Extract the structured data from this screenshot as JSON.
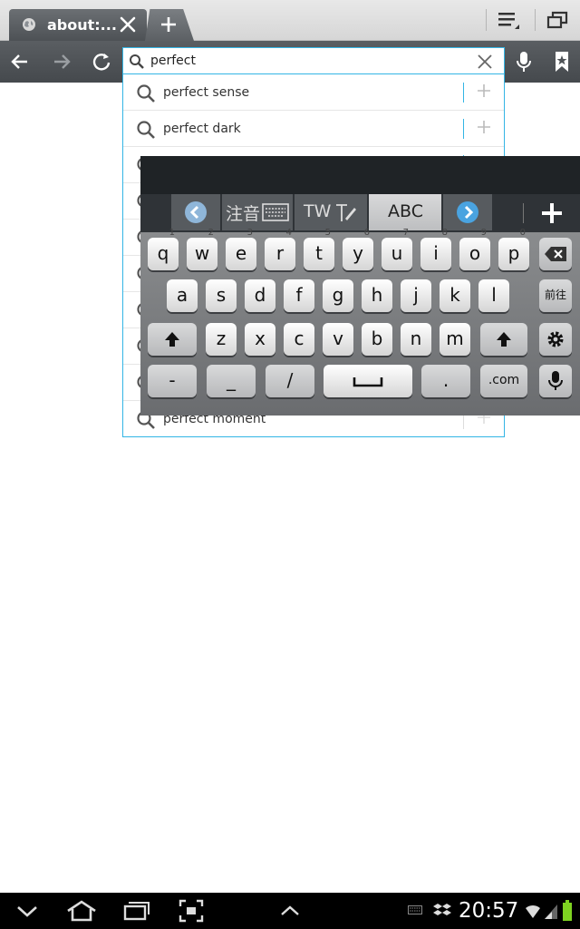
{
  "browser": {
    "tab_title": "about:...",
    "url_value": "perfect"
  },
  "suggestions": [
    "perfect sense",
    "perfect dark",
    "",
    "",
    "",
    "",
    "",
    "",
    "",
    "perfect moment"
  ],
  "keyboard": {
    "modes": [
      "注音",
      "TW",
      "ABC"
    ],
    "row1": [
      {
        "label": "q",
        "sup": "1"
      },
      {
        "label": "w",
        "sup": "2"
      },
      {
        "label": "e",
        "sup": "3"
      },
      {
        "label": "r",
        "sup": "4"
      },
      {
        "label": "t",
        "sup": "5"
      },
      {
        "label": "y",
        "sup": "6"
      },
      {
        "label": "u",
        "sup": "7"
      },
      {
        "label": "i",
        "sup": "8"
      },
      {
        "label": "o",
        "sup": "9"
      },
      {
        "label": "p",
        "sup": "0"
      }
    ],
    "row2": [
      "a",
      "s",
      "d",
      "f",
      "g",
      "h",
      "j",
      "k",
      "l"
    ],
    "row2_special": "前往",
    "row3": [
      "z",
      "x",
      "c",
      "v",
      "b",
      "n",
      "m"
    ],
    "row4": [
      "-",
      "_",
      "/",
      ".",
      ".com"
    ]
  },
  "status": {
    "time": "20:57"
  },
  "colors": {
    "accent": "#33b5e5",
    "toolbar": "#4f5357",
    "battery": "#7ed321"
  }
}
